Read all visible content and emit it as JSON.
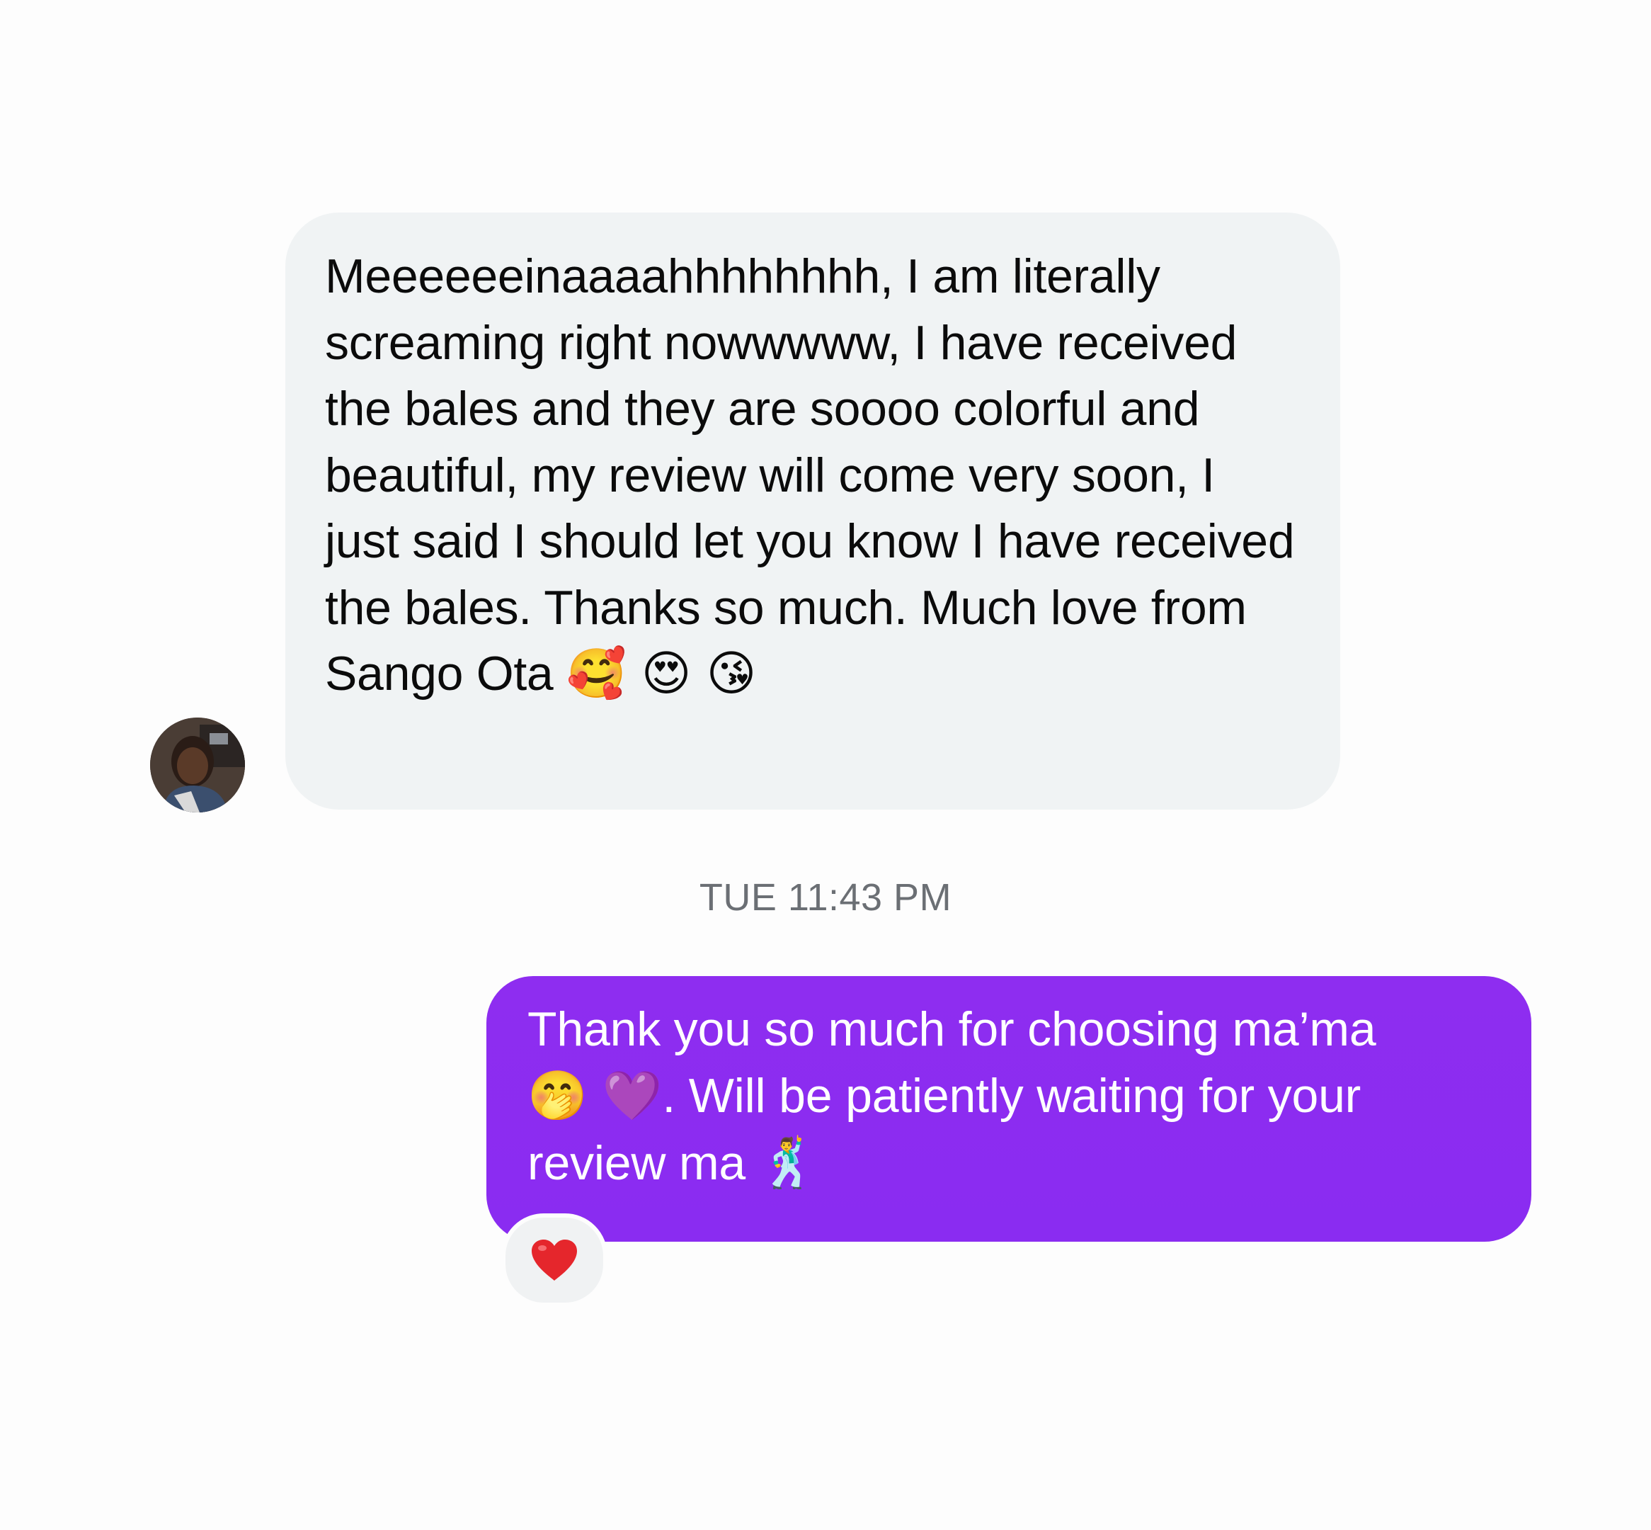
{
  "conversation": {
    "incoming": {
      "avatar_icon": "user-avatar-photo",
      "text": "Meeeeeeinaaaahhhhhhhh, I am literally screaming right nowwwww, I have received the bales and they are soooo colorful and beautiful, my review will come very soon, I just said I should let you know I have received the bales. Thanks so much. Much love from Sango Ota",
      "emojis": "🥰 😍 😘"
    },
    "timestamp": "TUE 11:43 PM",
    "outgoing": {
      "text_part1": "Thank you so much for choosing ma’ma",
      "emojis_inline": "🤭 💜",
      "text_part2": ". Will be patiently waiting for your review ma",
      "emoji_end": "🕺",
      "reaction": "❤️",
      "reaction_icon": "heart-icon"
    }
  },
  "colors": {
    "background": "#fdfdfd",
    "incoming_bubble": "#f0f3f4",
    "outgoing_bubble": "#8b2cf1",
    "timestamp": "#6b6f74",
    "reaction_heart": "#e5262c"
  }
}
